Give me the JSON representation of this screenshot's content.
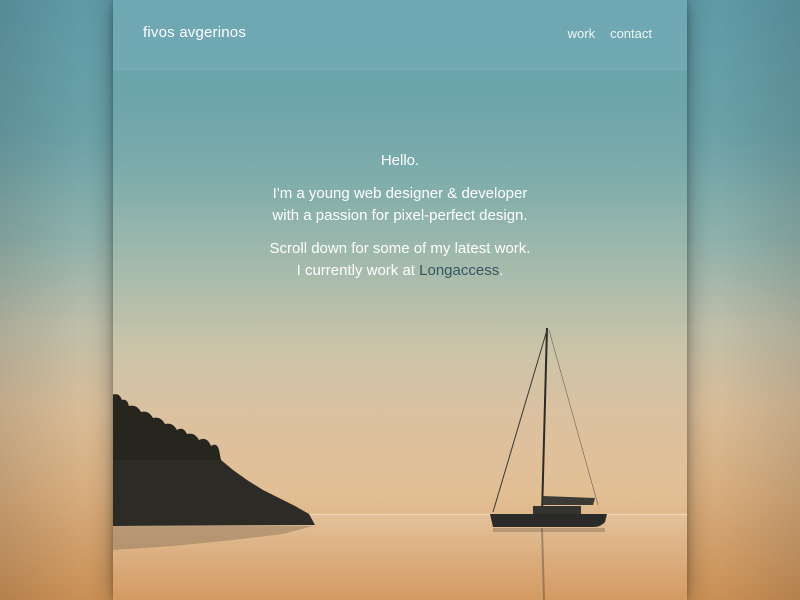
{
  "header": {
    "brand": "fivos avgerinos",
    "nav": [
      {
        "label": "work"
      },
      {
        "label": "contact"
      }
    ]
  },
  "intro": {
    "greeting": "Hello.",
    "line1": "I'm a young web designer & developer",
    "line2": "with a passion for pixel-perfect design.",
    "line3": "Scroll down for some of my latest work.",
    "line4_prefix": "I currently work at ",
    "company": "Longaccess",
    "line4_suffix": "."
  },
  "colors": {
    "sky_top": "#62a0ab",
    "sky_horizon": "#dcc1a0",
    "sea": "#d7a46f",
    "silhouette": "#2a2a26",
    "link_accent": "#355560"
  },
  "icons": {
    "hero": "sailboat-on-sea-photo"
  }
}
